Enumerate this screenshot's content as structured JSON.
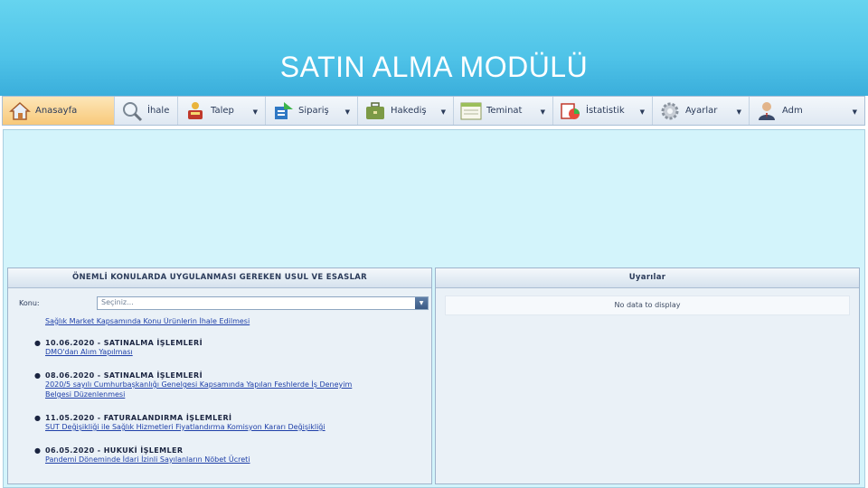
{
  "slide": {
    "title": "SATIN ALMA MODÜLÜ"
  },
  "menu": {
    "items": [
      {
        "label": "Anasayfa",
        "icon": "home-icon",
        "has_dropdown": false,
        "active": true
      },
      {
        "label": "İhale",
        "icon": "magnifier-icon",
        "has_dropdown": false,
        "active": false
      },
      {
        "label": "Talep",
        "icon": "request-basket-icon",
        "has_dropdown": true,
        "active": false
      },
      {
        "label": "Sipariş",
        "icon": "order-icon",
        "has_dropdown": true,
        "active": false
      },
      {
        "label": "Hakediş",
        "icon": "briefcase-icon",
        "has_dropdown": true,
        "active": false
      },
      {
        "label": "Teminat",
        "icon": "document-icon",
        "has_dropdown": true,
        "active": false
      },
      {
        "label": "İstatistik",
        "icon": "statistics-icon",
        "has_dropdown": true,
        "active": false
      },
      {
        "label": "Ayarlar",
        "icon": "gear-icon",
        "has_dropdown": true,
        "active": false
      },
      {
        "label": "Adm",
        "icon": "user-icon",
        "has_dropdown": true,
        "active": false
      }
    ],
    "caret": "▼"
  },
  "left_panel": {
    "title": "ÖNEMLİ KONULARDA UYGULANMASI GEREKEN USUL VE ESASLAR",
    "filter_label": "Konu:",
    "filter_placeholder": "Seçiniz...",
    "clipped_line": "Sağlık Market Kapsamında Konu Ürünlerin İhale Edilmesi",
    "items": [
      {
        "heading": "10.06.2020 - SATINALMA İŞLEMLERİ",
        "lines": [
          "DMO'dan Alım Yapılması"
        ]
      },
      {
        "heading": "08.06.2020 - SATINALMA İŞLEMLERİ",
        "lines": [
          "2020/5 sayılı Cumhurbaşkanlığı Genelgesi Kapsamında Yapılan Feshlerde İş Deneyim",
          "Belgesi Düzenlenmesi"
        ]
      },
      {
        "heading": "11.05.2020 - FATURALANDIRMA İŞLEMLERİ",
        "lines": [
          "SUT Değişikliği ile Sağlık Hizmetleri Fiyatlandırma Komisyon Kararı Değişikliği"
        ]
      },
      {
        "heading": "06.05.2020 - HUKUKİ İŞLEMLER",
        "lines": [
          "Pandemi Döneminde İdari İzinli Sayılanların Nöbet Ücreti"
        ]
      }
    ]
  },
  "right_panel": {
    "title": "Uyarılar",
    "empty_text": "No data to display"
  }
}
